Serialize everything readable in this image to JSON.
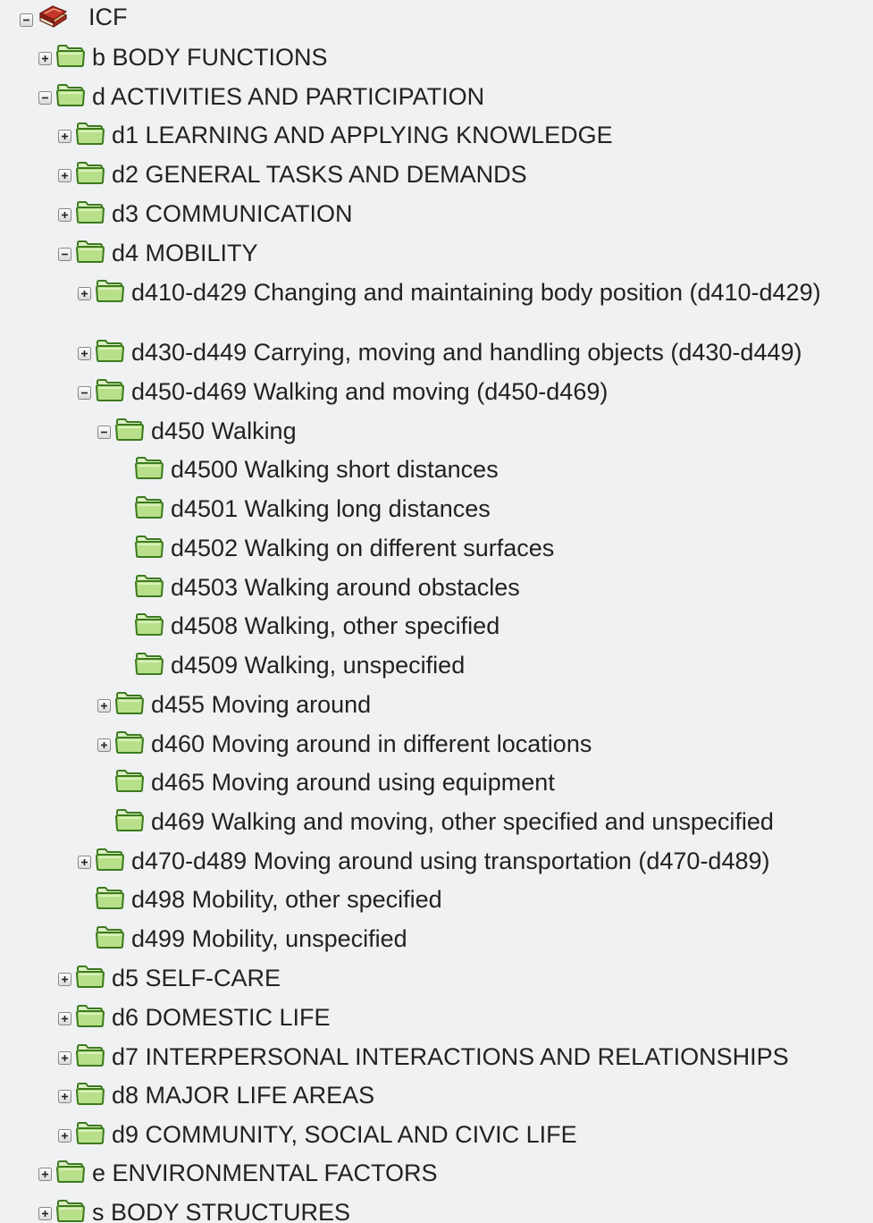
{
  "tree": {
    "nodes": [
      {
        "label": "ICF",
        "toggle": "minus",
        "icon": "book-icon"
      },
      {
        "label": "b BODY FUNCTIONS",
        "toggle": "plus",
        "icon": "folder-icon"
      },
      {
        "label": "d ACTIVITIES AND PARTICIPATION",
        "toggle": "minus",
        "icon": "folder-icon"
      },
      {
        "label": "d1 LEARNING AND APPLYING KNOWLEDGE",
        "toggle": "plus",
        "icon": "folder-icon"
      },
      {
        "label": "d2 GENERAL TASKS AND DEMANDS",
        "toggle": "plus",
        "icon": "folder-icon"
      },
      {
        "label": "d3 COMMUNICATION",
        "toggle": "plus",
        "icon": "folder-icon"
      },
      {
        "label": "d4 MOBILITY",
        "toggle": "minus",
        "icon": "folder-icon"
      },
      {
        "label": "d410-d429 Changing and maintaining body position (d410-d429)",
        "toggle": "plus",
        "icon": "folder-icon"
      },
      {
        "label": "d430-d449 Carrying, moving and handling objects (d430-d449)",
        "toggle": "plus",
        "icon": "folder-icon"
      },
      {
        "label": "d450-d469 Walking and moving (d450-d469)",
        "toggle": "minus",
        "icon": "folder-icon"
      },
      {
        "label": "d450 Walking",
        "toggle": "minus",
        "icon": "folder-icon"
      },
      {
        "label": "d4500 Walking short distances",
        "toggle": "none",
        "icon": "folder-icon"
      },
      {
        "label": "d4501 Walking long distances",
        "toggle": "none",
        "icon": "folder-icon"
      },
      {
        "label": "d4502 Walking on different surfaces",
        "toggle": "none",
        "icon": "folder-icon"
      },
      {
        "label": "d4503 Walking around obstacles",
        "toggle": "none",
        "icon": "folder-icon"
      },
      {
        "label": "d4508 Walking, other specified",
        "toggle": "none",
        "icon": "folder-icon"
      },
      {
        "label": "d4509 Walking, unspecified",
        "toggle": "none",
        "icon": "folder-icon"
      },
      {
        "label": "d455 Moving around",
        "toggle": "plus",
        "icon": "folder-icon"
      },
      {
        "label": "d460 Moving around in different locations",
        "toggle": "plus",
        "icon": "folder-icon"
      },
      {
        "label": "d465 Moving around using equipment",
        "toggle": "none",
        "icon": "folder-icon"
      },
      {
        "label": "d469 Walking and moving, other specified and unspecified",
        "toggle": "none",
        "icon": "folder-icon"
      },
      {
        "label": "d470-d489 Moving around using transportation (d470-d489)",
        "toggle": "plus",
        "icon": "folder-icon"
      },
      {
        "label": "d498 Mobility, other specified",
        "toggle": "none",
        "icon": "folder-icon"
      },
      {
        "label": "d499 Mobility, unspecified",
        "toggle": "none",
        "icon": "folder-icon"
      },
      {
        "label": "d5 SELF-CARE",
        "toggle": "plus",
        "icon": "folder-icon"
      },
      {
        "label": "d6 DOMESTIC LIFE",
        "toggle": "plus",
        "icon": "folder-icon"
      },
      {
        "label": "d7 INTERPERSONAL INTERACTIONS AND RELATIONSHIPS",
        "toggle": "plus",
        "icon": "folder-icon"
      },
      {
        "label": "d8 MAJOR LIFE AREAS",
        "toggle": "plus",
        "icon": "folder-icon"
      },
      {
        "label": "d9 COMMUNITY, SOCIAL AND CIVIC LIFE",
        "toggle": "plus",
        "icon": "folder-icon"
      },
      {
        "label": "e ENVIRONMENTAL FACTORS",
        "toggle": "plus",
        "icon": "folder-icon"
      },
      {
        "label": "s BODY STRUCTURES",
        "toggle": "plus",
        "icon": "folder-icon"
      }
    ]
  },
  "colors": {
    "background": "#f0f1f3",
    "folder_fill": "#b8e08a",
    "folder_stroke": "#3c7a1e",
    "toggle_border": "#888888",
    "text": "#222222"
  }
}
